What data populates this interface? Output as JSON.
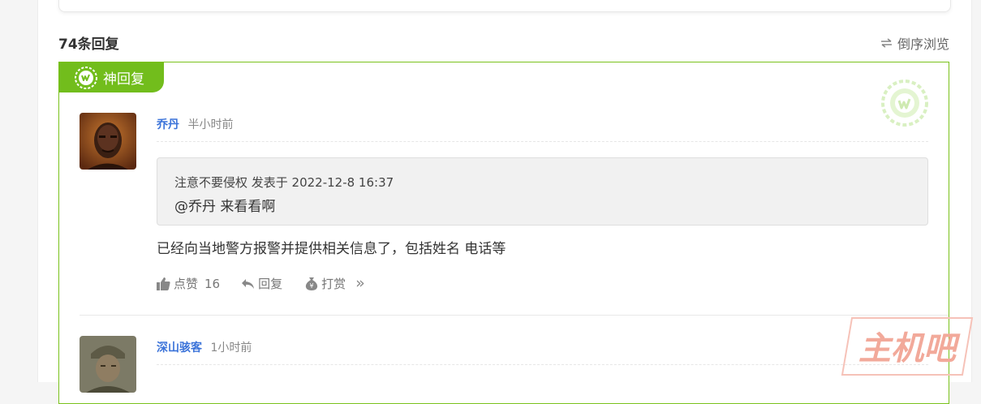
{
  "thread": {
    "reply_count_label": "74条回复",
    "sort_label": "倒序浏览"
  },
  "god_reply": {
    "tag_label": "神回复",
    "post": {
      "author": "乔丹",
      "time": "半小时前",
      "quote": {
        "header": "注意不要侵权 发表于 2022-12-8 16:37",
        "body": "@乔丹  来看看啊"
      },
      "content": "已经向当地警方报警并提供相关信息了，包括姓名 电话等",
      "actions": {
        "like_label": "点赞",
        "like_count": "16",
        "reply_label": "回复",
        "reward_label": "打赏",
        "more_label": "»"
      }
    }
  },
  "next_post": {
    "author": "深山骇客",
    "time": "1小时前"
  },
  "watermark": {
    "site_text": "主机吧"
  },
  "colors": {
    "god_green": "#72bd1c",
    "author_blue": "#3b73d9",
    "watermark_red": "#e8533d"
  },
  "icons": {
    "sort": "swap-arrows-icon",
    "tag": "god-reply-badge-icon",
    "like": "thumbs-up-icon",
    "reply": "reply-arrow-icon",
    "reward": "money-bag-icon",
    "more": "double-chevron-right-icon"
  }
}
